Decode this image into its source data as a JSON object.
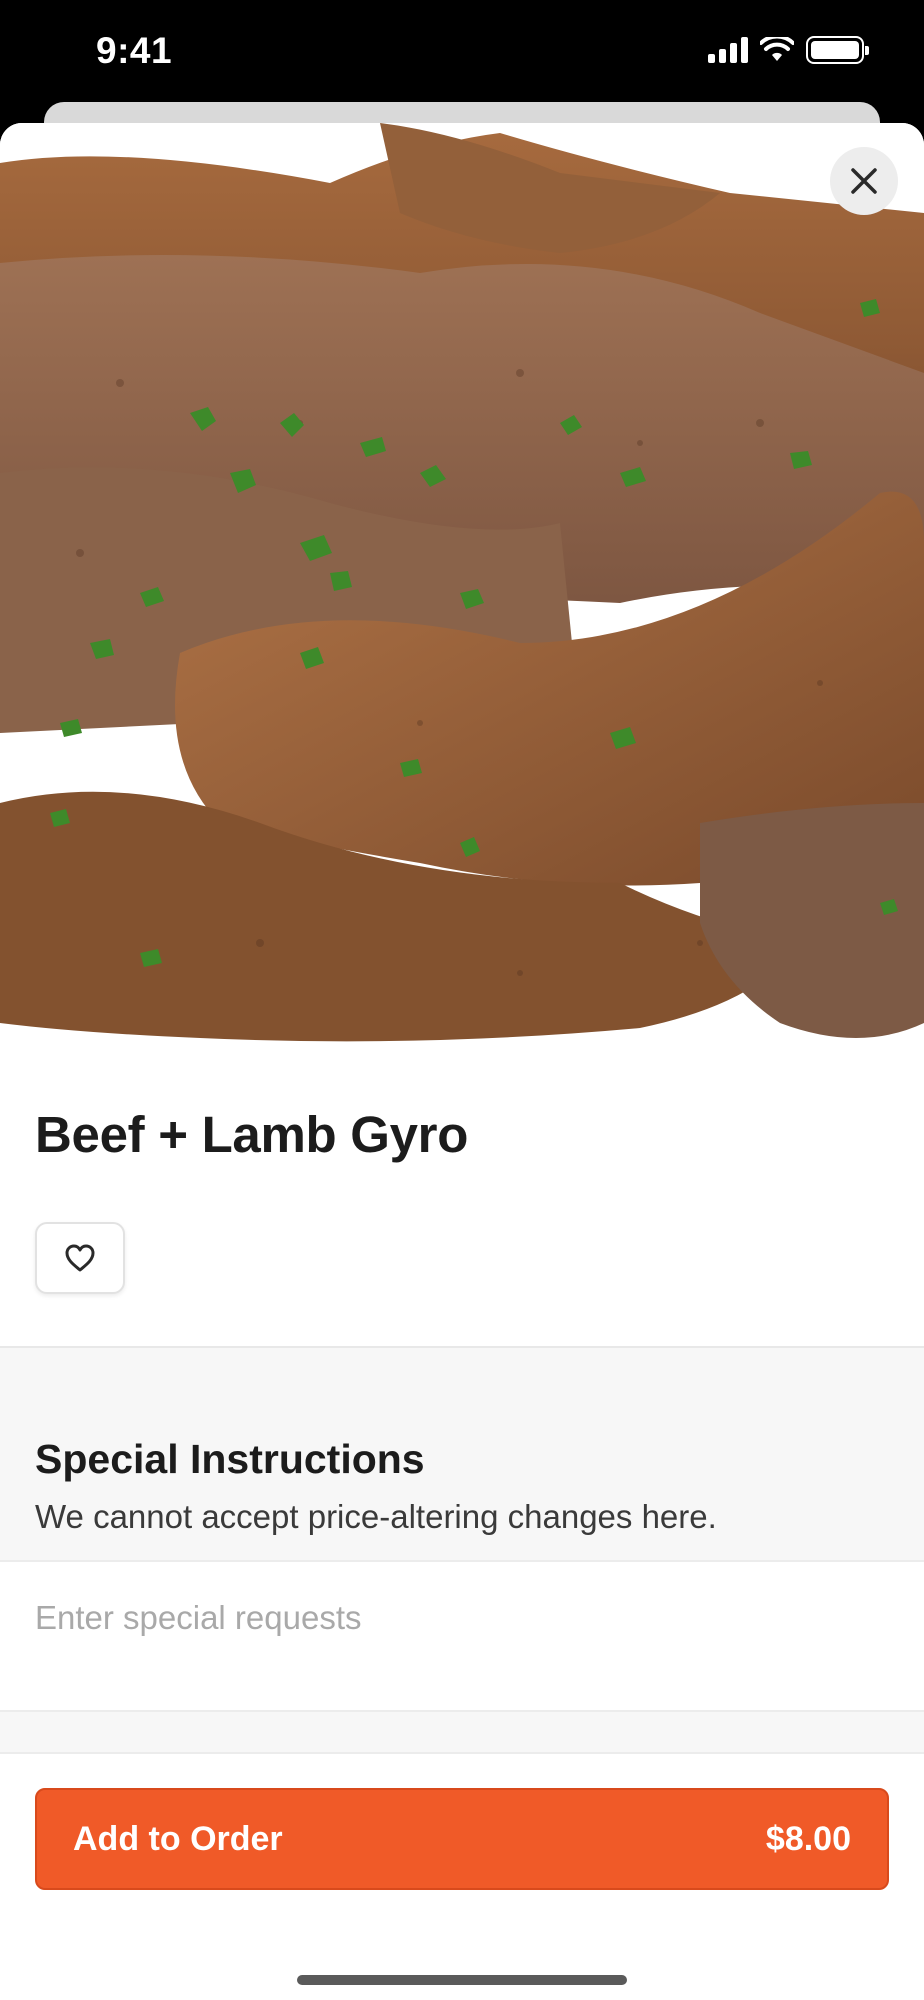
{
  "status_bar": {
    "time": "9:41",
    "icons": [
      "cellular-signal-icon",
      "wifi-icon",
      "battery-icon"
    ]
  },
  "item": {
    "title": "Beef + Lamb Gyro",
    "image": "sliced-gyro-meat-with-parsley-photo"
  },
  "actions": {
    "close_icon": "close-icon",
    "favorite_icon": "heart-outline-icon"
  },
  "special_instructions": {
    "title": "Special Instructions",
    "subtitle": "We cannot accept price-altering changes here.",
    "placeholder": "Enter special requests",
    "value": ""
  },
  "footer": {
    "add_label": "Add to Order",
    "price": "$8.00"
  },
  "colors": {
    "accent": "#f05a28",
    "text": "#1c1c1c",
    "muted_bg": "#f7f7f7"
  }
}
